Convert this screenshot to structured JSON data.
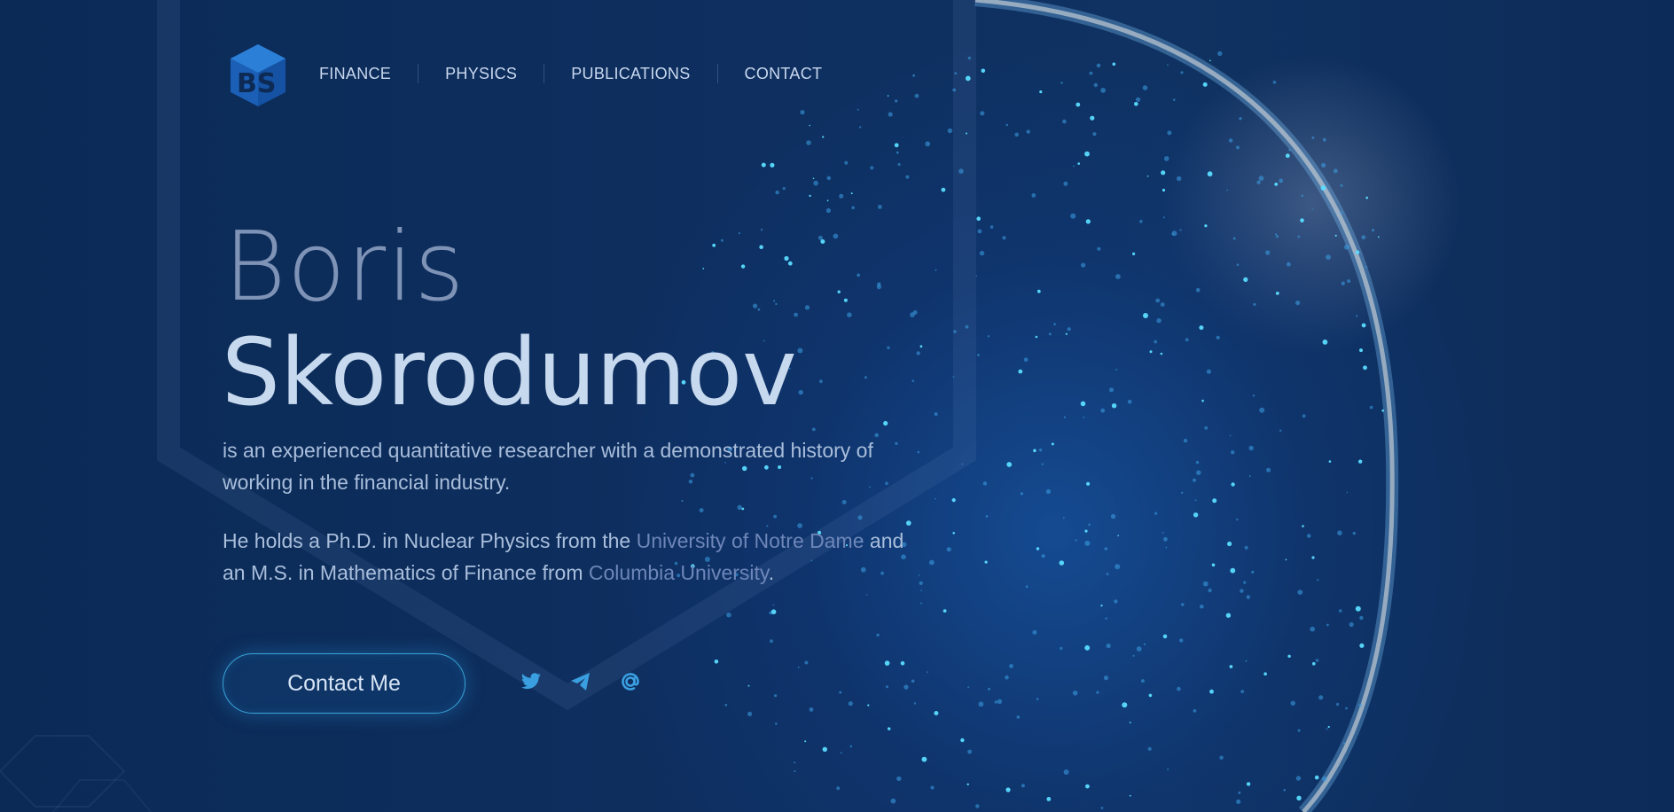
{
  "nav": {
    "items": [
      {
        "label": "FINANCE"
      },
      {
        "label": "PHYSICS"
      },
      {
        "label": "PUBLICATIONS"
      },
      {
        "label": "CONTACT"
      }
    ]
  },
  "logo": {
    "text": "BS"
  },
  "hero": {
    "first_name": "Boris",
    "last_name": "Skorodumov",
    "bio_line1": "is an experienced quantitative researcher with a demonstrated history of working in the financial industry.",
    "bio_line2_start": "He holds a Ph.D. in Nuclear Physics from the ",
    "bio_link1": "University of Notre Dame",
    "bio_line2_mid": " and an M.S. in Mathematics of Finance from ",
    "bio_link2": "Columbia University",
    "bio_line2_end": ".",
    "contact_button": "Contact Me"
  },
  "social": {
    "icons": [
      "twitter-icon",
      "telegram-icon",
      "email-at-icon"
    ]
  },
  "colors": {
    "background": "#0d2a55",
    "accent": "#3aa4d8",
    "icon": "#3a9fe0",
    "link": "#6e86b8"
  }
}
